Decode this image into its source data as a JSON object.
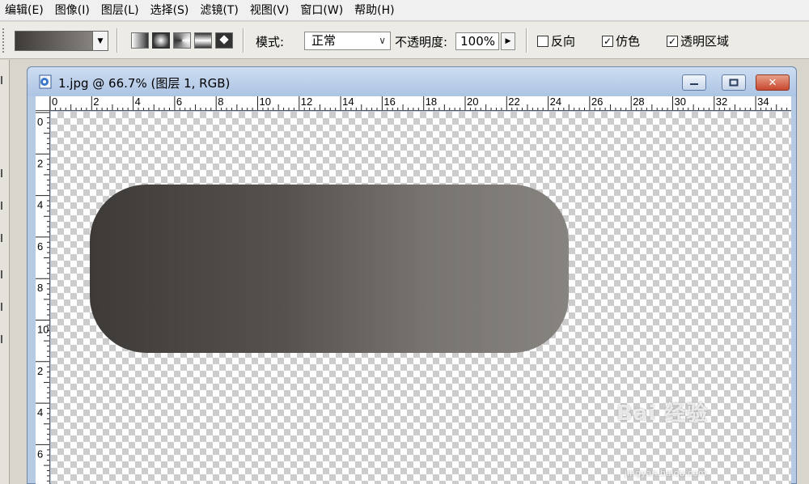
{
  "menubar": {
    "items": [
      "编辑(E)",
      "图像(I)",
      "图层(L)",
      "选择(S)",
      "滤镜(T)",
      "视图(V)",
      "窗口(W)",
      "帮助(H)"
    ]
  },
  "options": {
    "gradient_colors": [
      "#3e3a37",
      "#86837f"
    ],
    "mode_label": "模式:",
    "mode_value": "正常",
    "opacity_label": "不透明度:",
    "opacity_value": "100%",
    "reverse_label": "反向",
    "reverse_checked": false,
    "dither_label": "仿色",
    "dither_checked": true,
    "transparency_label": "透明区域",
    "transparency_checked": true
  },
  "document": {
    "title": "1.jpg @ 66.7% (图层 1, RGB)",
    "zoom_percent": 66.7,
    "ruler_top_labels": [
      "0",
      "2",
      "4",
      "6",
      "8",
      "10",
      "12",
      "14",
      "16",
      "18",
      "20",
      "22",
      "24",
      "26",
      "28",
      "30",
      "32",
      "34"
    ],
    "ruler_left_labels": [
      "0",
      "2",
      "4",
      "6",
      "8",
      "10",
      "2",
      "4",
      "6"
    ],
    "shape_gradient": [
      "#3e3a37",
      "#55514d",
      "#77746f",
      "#878480"
    ]
  },
  "watermark": {
    "text": "Bai 经验",
    "sub": "jingyan.baidu.com"
  }
}
